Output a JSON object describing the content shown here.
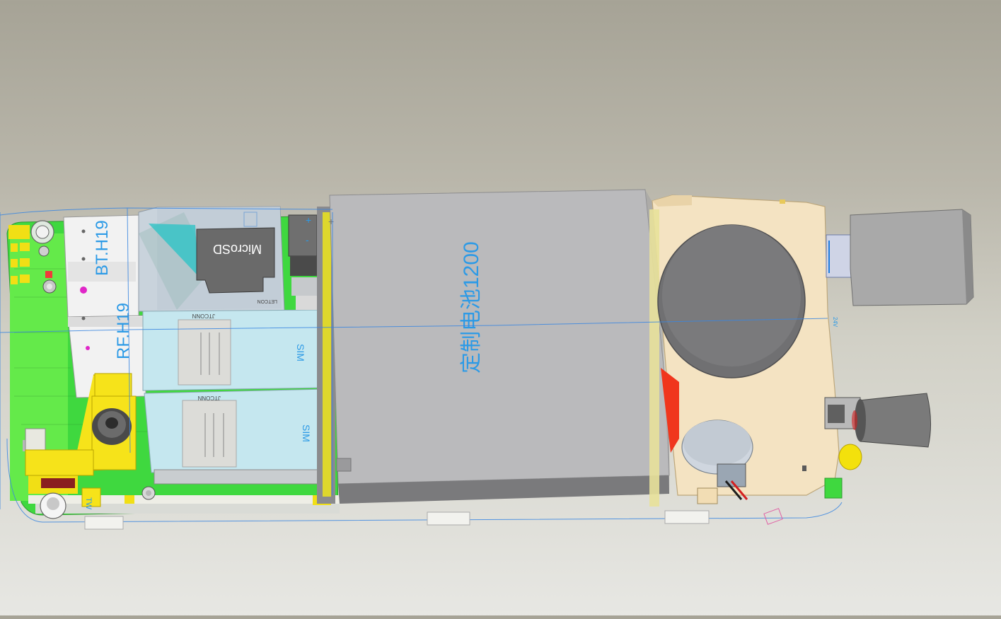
{
  "board": {
    "bt_label": "BT.H19",
    "rf_label": "RF.H19",
    "tw_label": "TW",
    "sd_label": "MicroSD",
    "sd_brand": "LETCON",
    "sim1_label": "SIM",
    "sim2_label": "SIM",
    "sim1_brand": "JTCONN",
    "sim2_brand": "JTCONN",
    "battery_label": "定制电池1200",
    "battery_plus": "+",
    "connector_plus": "+",
    "connector_minus": "-",
    "side_tag": "24V"
  },
  "colors": {
    "pcb_green": "#3cdc3c",
    "battery_gray": "#b9b9bb",
    "speaker_body": "#f3e2bf",
    "sim_holder": "#c4e6ee",
    "outline_blue": "#3a86e0",
    "label_blue": "#2c9ae6",
    "accent_yellow": "#f3e10c",
    "accent_red": "#f0361c"
  }
}
